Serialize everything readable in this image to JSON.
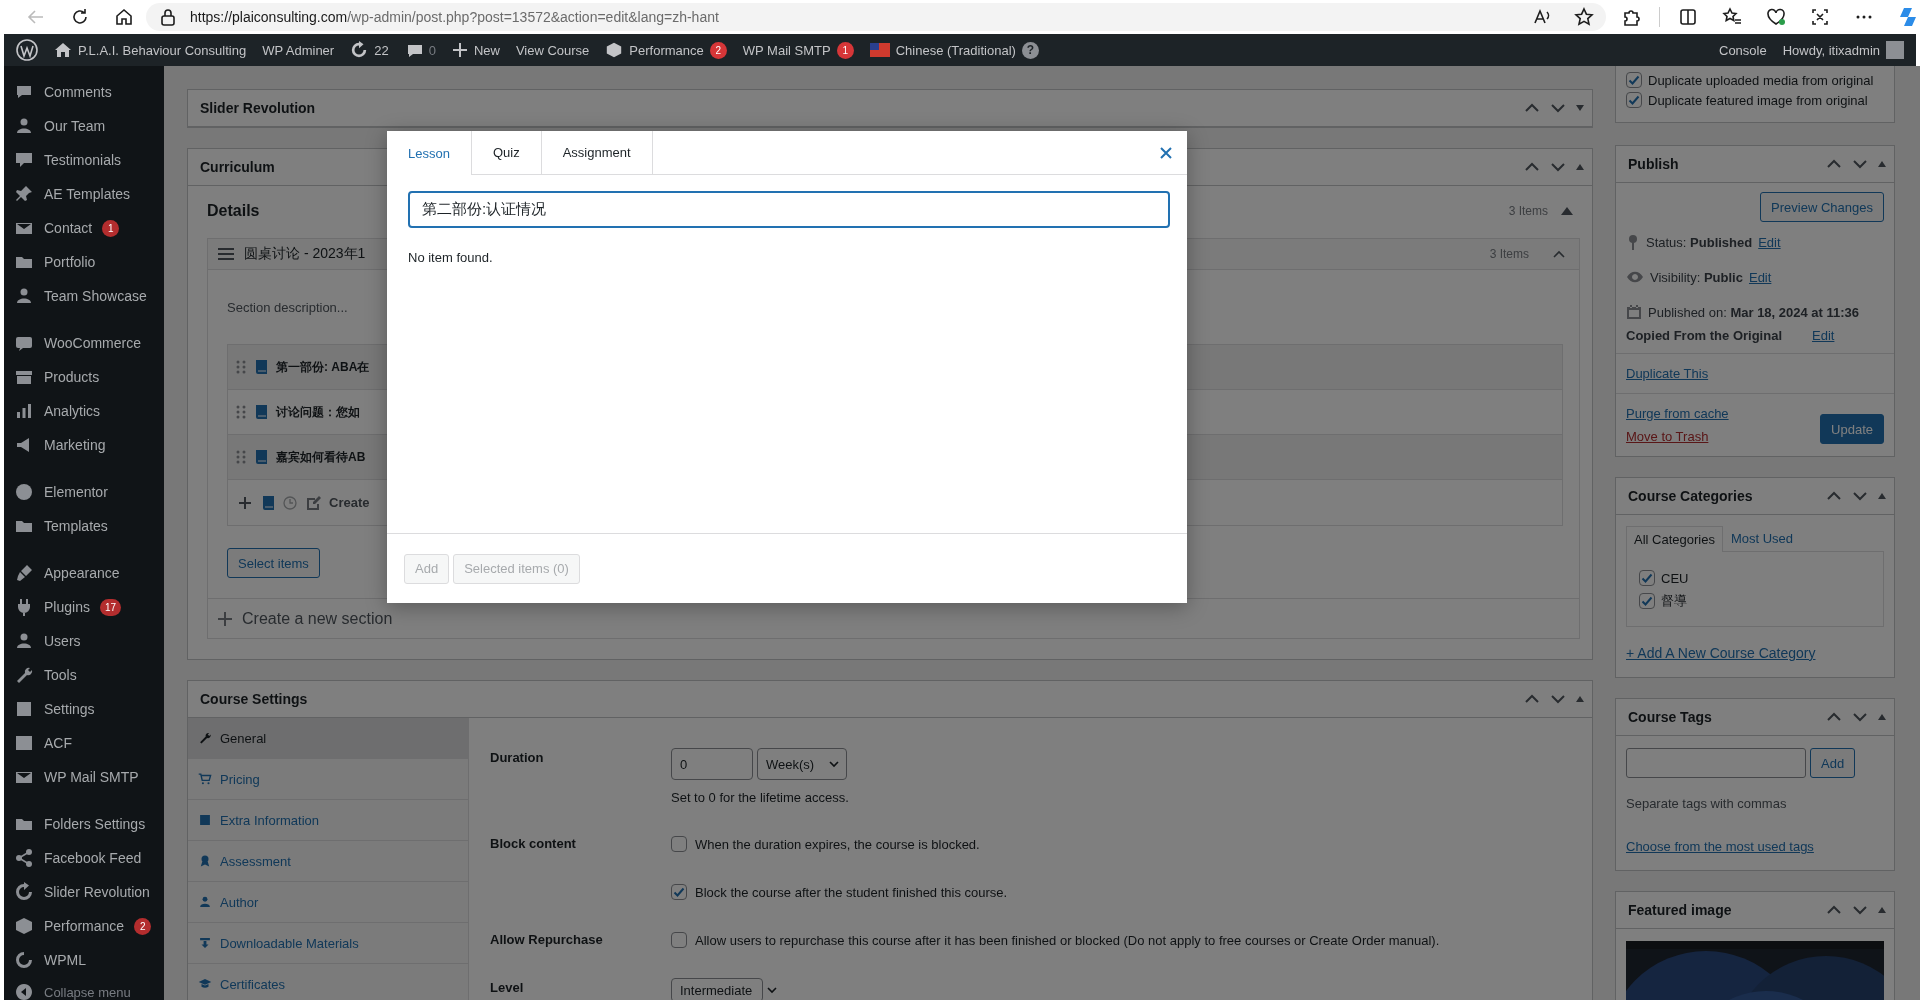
{
  "browser": {
    "url_host": "https://plaiconsulting.com",
    "url_path": "/wp-admin/post.php?post=13572&action=edit&lang=zh-hant"
  },
  "admin_bar": {
    "left": [
      {
        "kind": "logo"
      },
      {
        "kind": "home",
        "label": "P.L.A.I. Behaviour Consulting"
      },
      {
        "kind": "text",
        "label": "WP Adminer"
      },
      {
        "kind": "updates",
        "label": "22"
      },
      {
        "kind": "comments",
        "label": "0"
      },
      {
        "kind": "new",
        "label": "New"
      },
      {
        "kind": "text",
        "label": "View Course"
      },
      {
        "kind": "performance",
        "label": "Performance",
        "badge": "2"
      },
      {
        "kind": "text",
        "label": "WP Mail SMTP",
        "badge": "1"
      },
      {
        "kind": "language",
        "label": "Chinese (Traditional)",
        "help": "?"
      }
    ],
    "right": [
      {
        "kind": "text",
        "label": "Console"
      },
      {
        "kind": "account",
        "label": "Howdy, itixadmin"
      }
    ]
  },
  "sidebar": {
    "groups": [
      {
        "items": [
          {
            "label": "Comments"
          },
          {
            "label": "Our Team"
          },
          {
            "label": "Testimonials"
          },
          {
            "label": "AE Templates"
          },
          {
            "label": "Contact",
            "badge": "1"
          },
          {
            "label": "Portfolio"
          },
          {
            "label": "Team Showcase"
          }
        ]
      },
      {
        "items": [
          {
            "label": "WooCommerce"
          },
          {
            "label": "Products"
          },
          {
            "label": "Analytics"
          },
          {
            "label": "Marketing"
          }
        ]
      },
      {
        "items": [
          {
            "label": "Elementor"
          },
          {
            "label": "Templates"
          }
        ]
      },
      {
        "items": [
          {
            "label": "Appearance"
          },
          {
            "label": "Plugins",
            "badge": "17"
          },
          {
            "label": "Users"
          },
          {
            "label": "Tools"
          },
          {
            "label": "Settings"
          },
          {
            "label": "ACF"
          },
          {
            "label": "WP Mail SMTP"
          }
        ]
      },
      {
        "items": [
          {
            "label": "Folders Settings"
          },
          {
            "label": "Facebook Feed"
          },
          {
            "label": "Slider Revolution"
          },
          {
            "label": "Performance",
            "badge": "2"
          },
          {
            "label": "WPML"
          }
        ]
      }
    ],
    "collapse_menu": "Collapse menu"
  },
  "slider_revolution": {
    "title": "Slider Revolution",
    "expanded": false
  },
  "curriculum": {
    "title": "Curriculum",
    "details": {
      "label": "Details",
      "count": "3 Items"
    },
    "sections": [
      {
        "title": "圆桌讨论 - 2023年1",
        "count": "3 Items",
        "description_placeholder": "Section description...",
        "items": [
          {
            "title": "第一部份: ABA在"
          },
          {
            "title": "讨论问题：您如"
          },
          {
            "title": "嘉宾如何看待AB"
          }
        ],
        "new_item_placeholder": "Create"
      }
    ],
    "select_button": "Select items",
    "new_section_placeholder": "Create a new section"
  },
  "course_settings": {
    "title": "Course Settings",
    "tabs": [
      {
        "label": "General",
        "selected": true
      },
      {
        "label": "Pricing",
        "selected": false
      },
      {
        "label": "Extra Information",
        "selected": false
      },
      {
        "label": "Assessment",
        "selected": false
      },
      {
        "label": "Author",
        "selected": false
      },
      {
        "label": "Downloadable Materials",
        "selected": false
      },
      {
        "label": "Certificates",
        "selected": false
      }
    ],
    "fields": [
      {
        "kind": "duration",
        "label": "Duration",
        "value": "0",
        "unit": "Week(s)",
        "hint": "Set to 0 for the lifetime access."
      },
      {
        "kind": "checkboxes",
        "label": "Block content",
        "options": [
          {
            "text": "When the duration expires, the course is blocked.",
            "checked": false
          },
          {
            "text": "Block the course after the student finished this course.",
            "checked": true
          }
        ]
      },
      {
        "kind": "checkboxes",
        "label": "Allow Repurchase",
        "options": [
          {
            "text": "Allow users to repurchase this course after it has been finished or blocked (Do not apply to free courses or Create Order manual).",
            "checked": false
          }
        ]
      },
      {
        "kind": "select",
        "label": "Level",
        "value": "Intermediate"
      }
    ]
  },
  "translation_options": [
    {
      "label": "Duplicate uploaded media from original",
      "checked": true
    },
    {
      "label": "Duplicate featured image from original",
      "checked": true
    }
  ],
  "publish": {
    "title": "Publish",
    "preview_button": "Preview Changes",
    "status": "Status: **Published**",
    "status_edit": "Edit",
    "visibility": "Visibility: **Public**",
    "visibility_edit": "Edit",
    "published_on": "Published on: **Mar 18, 2024 at 11:36**",
    "copied": "Copied From the Original",
    "copied_edit": "Edit",
    "duplicate_link": "Duplicate This",
    "purge_link": "Purge from cache",
    "trash_link": "Move to Trash",
    "update_button": "Update"
  },
  "course_categories": {
    "title": "Course Categories",
    "tabs": [
      {
        "label": "All Categories",
        "selected": true
      },
      {
        "label": "Most Used",
        "selected": false
      }
    ],
    "categories": [
      {
        "label": "CEU",
        "checked": true
      },
      {
        "label": "督導",
        "checked": true
      }
    ],
    "add_link": "+ Add A New Course Category"
  },
  "course_tags": {
    "title": "Course Tags",
    "add_button": "Add",
    "hint": "Separate tags with commas",
    "choose_link": "Choose from the most used tags"
  },
  "featured_image": {
    "title": "Featured image"
  },
  "modal": {
    "tabs": [
      {
        "label": "Lesson",
        "selected": true
      },
      {
        "label": "Quiz",
        "selected": false
      },
      {
        "label": "Assignment",
        "selected": false
      }
    ],
    "search_value": "第二部份:认证情况",
    "empty_message": "No item found.",
    "add_button": "Add",
    "add_disabled": true,
    "selected_button": "Selected items (0)",
    "selected_disabled": true
  }
}
